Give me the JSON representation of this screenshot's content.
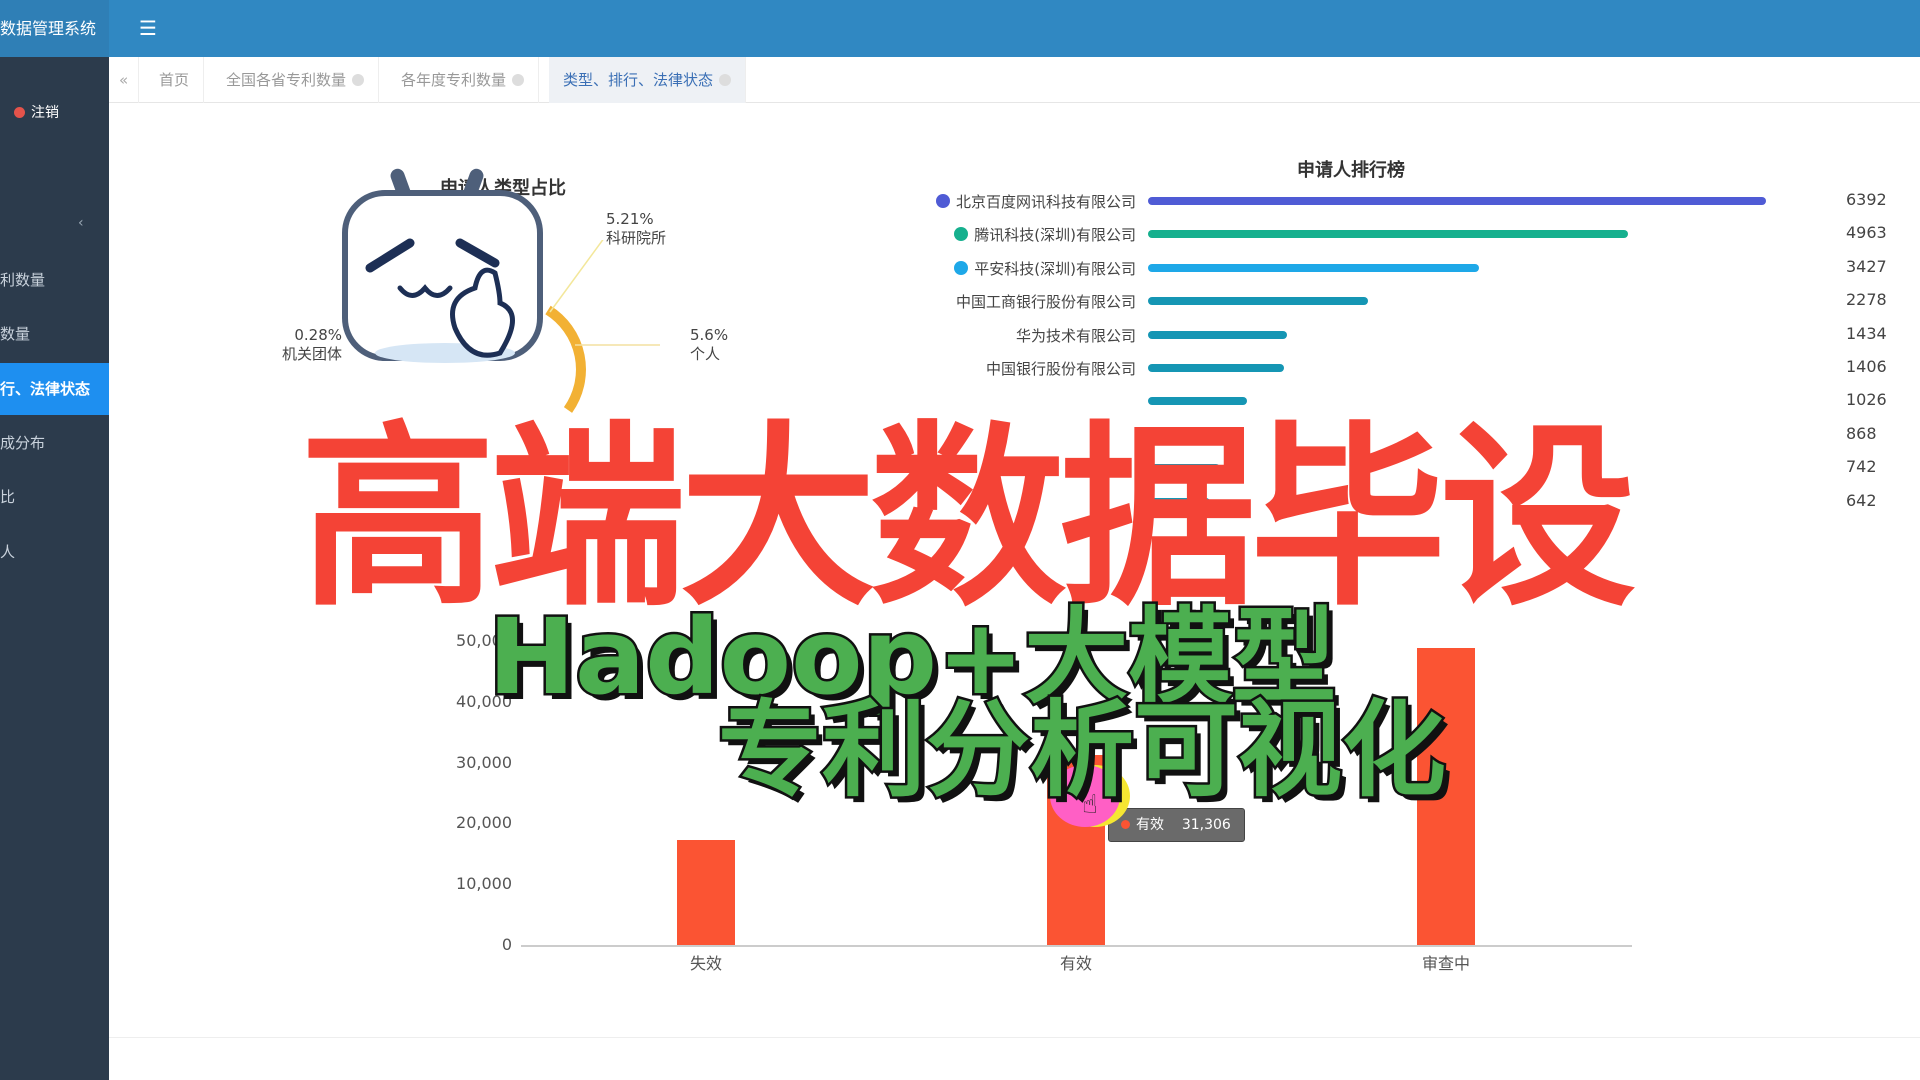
{
  "app": {
    "title": "数据管理系统",
    "logout": "注销",
    "menu_icon": "hamburger-icon"
  },
  "sidebar": {
    "items": [
      {
        "label": "利数量"
      },
      {
        "label": "数量"
      },
      {
        "label": "行、法律状态",
        "active": true
      },
      {
        "label": "成分布"
      },
      {
        "label": "比"
      },
      {
        "label": "人"
      }
    ]
  },
  "tabs": [
    {
      "label": "首页"
    },
    {
      "label": "全国各省专利数量"
    },
    {
      "label": "各年度专利数量"
    },
    {
      "label": "类型、排行、法律状态",
      "active": true
    }
  ],
  "pie": {
    "title": "申请人类型占比",
    "labels": [
      {
        "pct": "5.21%",
        "name": "科研院所"
      },
      {
        "pct": "0.28%",
        "name": "机关团体"
      },
      {
        "pct": "5.6%",
        "name": "个人"
      }
    ]
  },
  "ranking": {
    "title": "申请人排行榜",
    "items": [
      {
        "rank": "1",
        "name": "北京百度网讯科技有限公司",
        "value": 6392,
        "color": "#4f5bd5"
      },
      {
        "rank": "2",
        "name": "腾讯科技(深圳)有限公司",
        "value": 4963,
        "color": "#16b08e"
      },
      {
        "rank": "3",
        "name": "平安科技(深圳)有限公司",
        "value": 3427,
        "color": "#1ea8e8"
      },
      {
        "rank": "",
        "name": "中国工商银行股份有限公司",
        "value": 2278,
        "color": "#1596b4"
      },
      {
        "rank": "",
        "name": "华为技术有限公司",
        "value": 1434,
        "color": "#1596b4"
      },
      {
        "rank": "",
        "name": "中国银行股份有限公司",
        "value": 1406,
        "color": "#1596b4"
      },
      {
        "rank": "",
        "name": "",
        "value": 1026,
        "color": "#1596b4"
      },
      {
        "rank": "",
        "name": "",
        "value": 868,
        "color": "#1596b4"
      },
      {
        "rank": "",
        "name": "",
        "value": 742,
        "color": "#1596b4"
      },
      {
        "rank": "",
        "name": "",
        "value": 642,
        "color": "#1596b4"
      }
    ]
  },
  "chart_data": {
    "type": "bar",
    "categories": [
      "失效",
      "有效",
      "审查中"
    ],
    "values": [
      17200,
      31306,
      48800
    ],
    "ylim": [
      0,
      50000
    ],
    "yticks": [
      "0",
      "10,000",
      "20,000",
      "30,000",
      "40,000",
      "50,000"
    ],
    "color": "#fb5433",
    "grid": false
  },
  "tooltip": {
    "label": "有效",
    "value": "31,306"
  },
  "overlay": {
    "title": "高端大数据毕设",
    "line2": "Hadoop+大模型",
    "line3": "专利分析可视化"
  }
}
